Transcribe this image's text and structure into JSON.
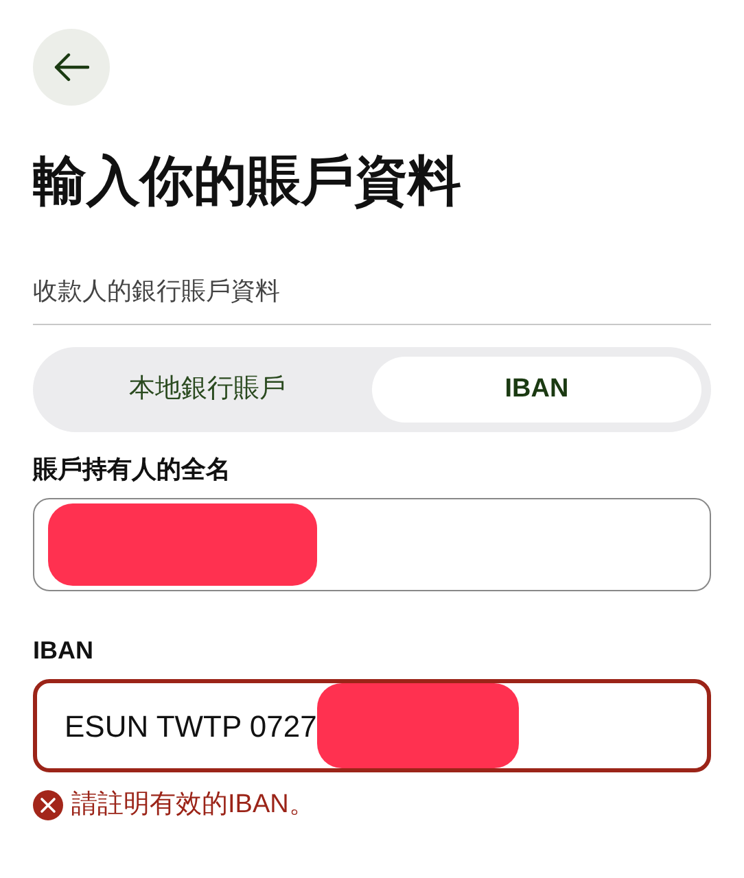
{
  "title": "輸入你的賬戶資料",
  "section_label": "收款人的銀行賬戶資料",
  "tabs": [
    {
      "label": "本地銀行賬戶",
      "selected": false
    },
    {
      "label": "IBAN",
      "selected": true
    }
  ],
  "fields": [
    {
      "label": "賬戶持有人的全名",
      "redacted": true,
      "error": false
    },
    {
      "label": "IBAN",
      "value": "ESUN TWTP 0727",
      "redacted": true,
      "error": true,
      "error_message": "請註明有效的IBAN。"
    }
  ]
}
